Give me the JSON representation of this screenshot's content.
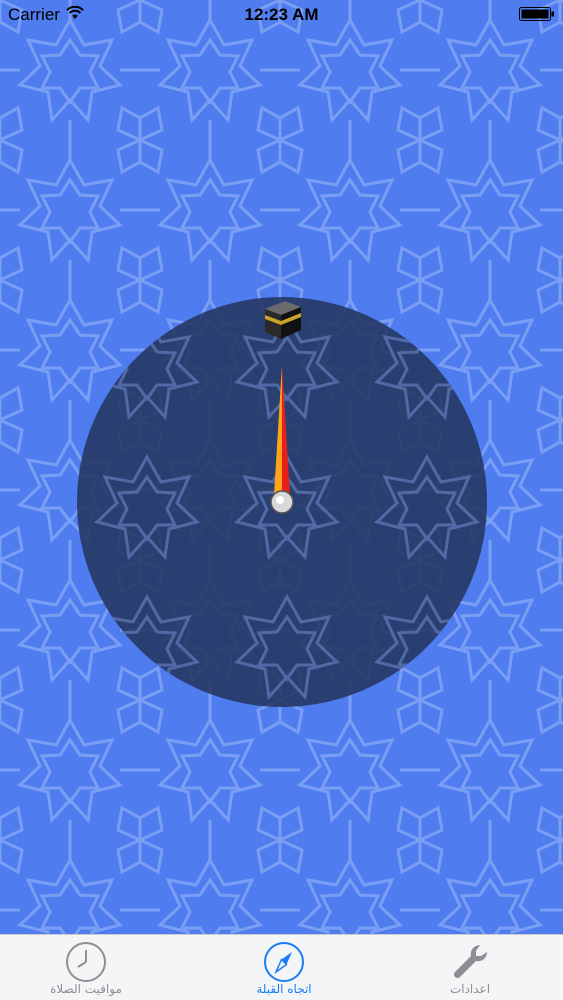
{
  "status_bar": {
    "carrier": "Carrier",
    "time": "12:23 AM",
    "wifi_icon": "wifi-icon",
    "battery_icon": "battery-icon"
  },
  "compass": {
    "kaaba_icon": "kaaba-icon",
    "needle_colors": {
      "left": "#ffa31a",
      "right": "#e8201a"
    },
    "dial_color": "#22335a"
  },
  "tab_bar": {
    "active_tab": "qibla",
    "active_color": "#1b7cf6",
    "inactive_color": "#8e8e93",
    "tabs": [
      {
        "id": "prayer-times",
        "label": "مواقيت الصلاة",
        "icon": "clock-icon"
      },
      {
        "id": "qibla",
        "label": "اتجاه القبلة",
        "icon": "compass-icon"
      },
      {
        "id": "settings",
        "label": "اعدادات",
        "icon": "wrench-icon"
      }
    ]
  },
  "background": {
    "color": "#4f7df0",
    "pattern": "islamic-star-pattern"
  }
}
